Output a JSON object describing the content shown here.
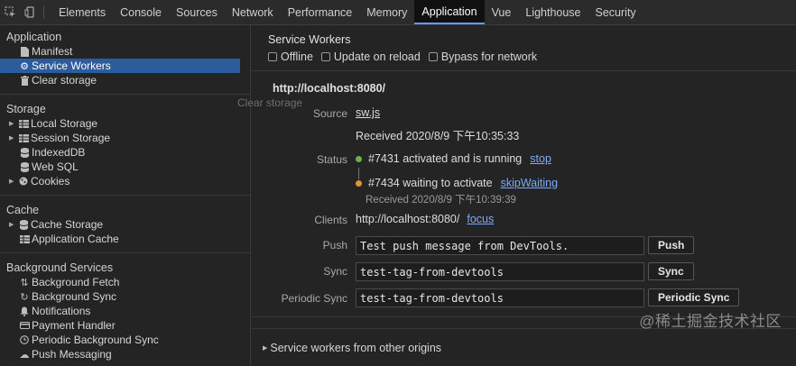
{
  "toolbar": {
    "tabs": [
      "Elements",
      "Console",
      "Sources",
      "Network",
      "Performance",
      "Memory",
      "Application",
      "Vue",
      "Lighthouse",
      "Security"
    ],
    "active_tab": "Application"
  },
  "sidebar": {
    "application": {
      "title": "Application",
      "items": [
        "Manifest",
        "Service Workers",
        "Clear storage"
      ]
    },
    "storage": {
      "title": "Storage",
      "items": [
        "Local Storage",
        "Session Storage",
        "IndexedDB",
        "Web SQL",
        "Cookies"
      ]
    },
    "cache": {
      "title": "Cache",
      "items": [
        "Cache Storage",
        "Application Cache"
      ]
    },
    "background": {
      "title": "Background Services",
      "items": [
        "Background Fetch",
        "Background Sync",
        "Notifications",
        "Payment Handler",
        "Periodic Background Sync",
        "Push Messaging"
      ]
    }
  },
  "main": {
    "header": "Service Workers",
    "options": [
      "Offline",
      "Update on reload",
      "Bypass for network"
    ],
    "origin": "http://localhost:8080/",
    "ghost_label": "Clear storage",
    "source": {
      "label": "Source",
      "link": "sw.js",
      "received": "Received 2020/8/9 下午10:35:33"
    },
    "status": {
      "label": "Status",
      "active": {
        "text": "#7431 activated and is running",
        "action": "stop",
        "color": "#6ab04c"
      },
      "waiting": {
        "text": "#7434 waiting to activate",
        "action": "skipWaiting",
        "color": "#e0962e",
        "received": "Received 2020/8/9 下午10:39:39"
      }
    },
    "clients": {
      "label": "Clients",
      "value": "http://localhost:8080/",
      "action": "focus"
    },
    "push": {
      "label": "Push",
      "value": "Test push message from DevTools.",
      "button": "Push"
    },
    "sync": {
      "label": "Sync",
      "value": "test-tag-from-devtools",
      "button": "Sync"
    },
    "periodic_sync": {
      "label": "Periodic Sync",
      "value": "test-tag-from-devtools",
      "button": "Periodic Sync"
    },
    "other_origins": "Service workers from other origins"
  },
  "watermark": "@稀土掘金技术社区"
}
